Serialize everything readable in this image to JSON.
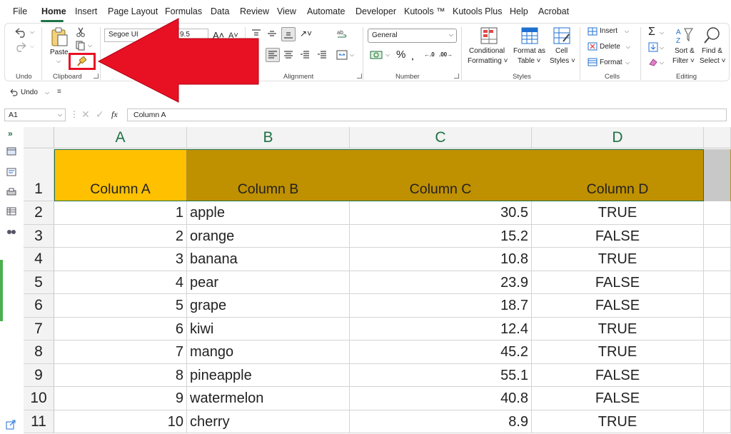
{
  "menu": {
    "items": [
      "File",
      "Home",
      "Insert",
      "Page Layout",
      "Formulas",
      "Data",
      "Review",
      "View",
      "Automate",
      "Developer",
      "Kutools ™",
      "Kutools Plus",
      "Help",
      "Acrobat"
    ],
    "active": "Home"
  },
  "ribbon": {
    "undo_group": "Undo",
    "clipboard_group": "Clipboard",
    "paste_label": "Paste",
    "font_name": "Segoe UI",
    "font_size": "9.5",
    "alignment_group": "Alignment",
    "number_group": "Number",
    "number_format": "General",
    "conditional_formatting": [
      "Conditional",
      "Formatting ˅"
    ],
    "format_as_table": [
      "Format as",
      "Table ˅"
    ],
    "cell_styles": [
      "Cell",
      "Styles ˅"
    ],
    "styles_group": "Styles",
    "insert_label": "Insert",
    "delete_label": "Delete",
    "format_label": "Format",
    "cells_group": "Cells",
    "sort_filter": [
      "Sort &",
      "Filter ˅"
    ],
    "find_select": [
      "Find &",
      "Select ˅"
    ],
    "editing_group": "Editing"
  },
  "qat": {
    "undo_label": "Undo"
  },
  "formula_bar": {
    "name_box": "A1",
    "fx": "fx",
    "content": "Column A"
  },
  "columns": [
    "A",
    "B",
    "C",
    "D"
  ],
  "rows": [
    "1",
    "2",
    "3",
    "4",
    "5",
    "6",
    "7",
    "8",
    "9",
    "10",
    "11"
  ],
  "headers": [
    "Column A",
    "Column B",
    "Column C",
    "Column D"
  ],
  "table": [
    [
      "1",
      "apple",
      "30.5",
      "TRUE"
    ],
    [
      "2",
      "orange",
      "15.2",
      "FALSE"
    ],
    [
      "3",
      "banana",
      "10.8",
      "TRUE"
    ],
    [
      "4",
      "pear",
      "23.9",
      "FALSE"
    ],
    [
      "5",
      "grape",
      "18.7",
      "FALSE"
    ],
    [
      "6",
      "kiwi",
      "12.4",
      "TRUE"
    ],
    [
      "7",
      "mango",
      "45.2",
      "TRUE"
    ],
    [
      "8",
      "pineapple",
      "55.1",
      "FALSE"
    ],
    [
      "9",
      "watermelon",
      "40.8",
      "FALSE"
    ],
    [
      "10",
      "cherry",
      "8.9",
      "TRUE"
    ]
  ],
  "colors": {
    "accent_green": "#1e7145",
    "header_a_fill": "#ffc000",
    "header_fill": "#bf9000",
    "annotation_red": "#e81123"
  },
  "icons": {
    "format_painter": "format-painter-icon",
    "annotation": "red-arrow-pointing-to-format-painter"
  }
}
